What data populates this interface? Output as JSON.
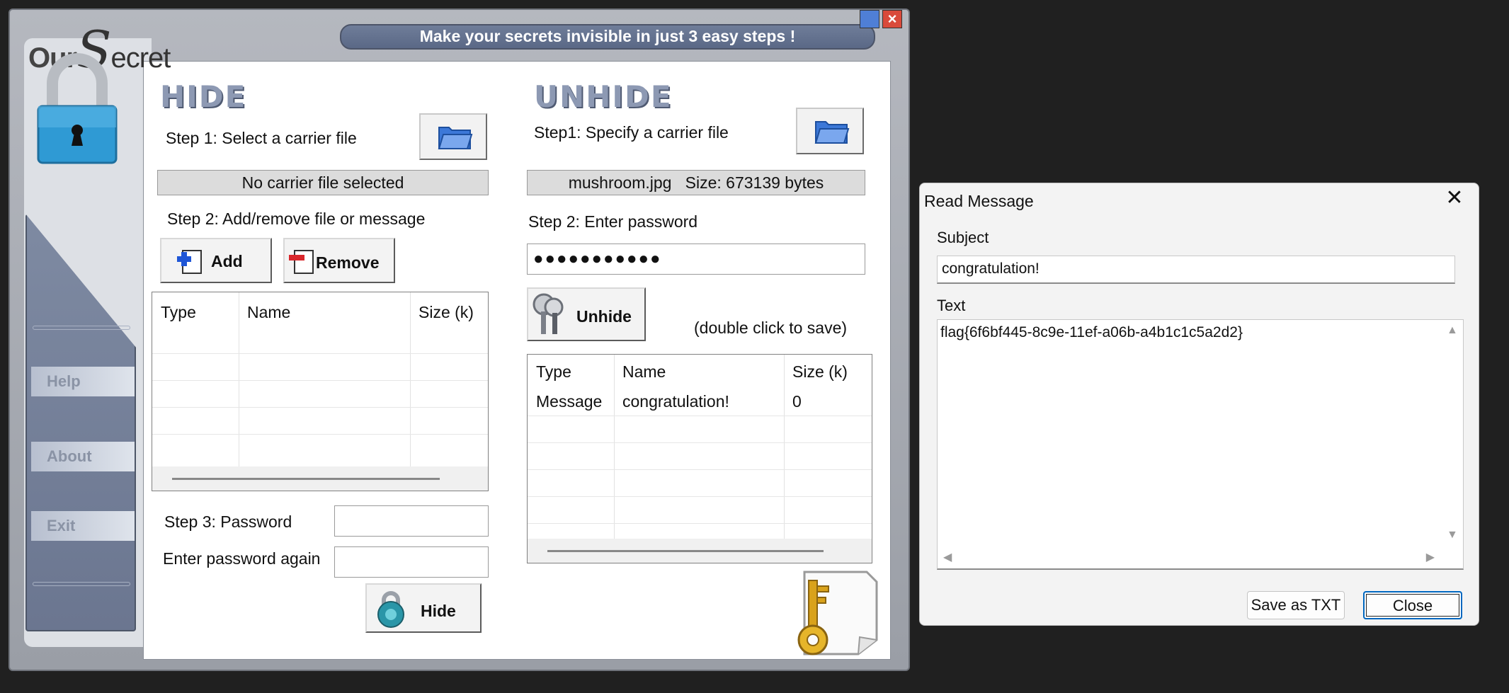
{
  "app": {
    "logo_our": "Our",
    "logo_s": "S",
    "logo_rest": "ecret",
    "banner": "Make your secrets invisible in just 3 easy steps !",
    "nav": {
      "help": "Help",
      "about": "About",
      "exit": "Exit"
    }
  },
  "hide": {
    "title": "HIDE",
    "step1": "Step 1: Select a carrier file",
    "carrier_status": "No carrier file selected",
    "step2": "Step 2: Add/remove file or message",
    "add_label": "Add",
    "remove_label": "Remove",
    "columns": [
      "Type",
      "Name",
      "Size (k)"
    ],
    "step3": "Step 3: Password",
    "password_again": "Enter password again",
    "password_value": "",
    "password_again_value": "",
    "hide_label": "Hide"
  },
  "unhide": {
    "title": "UNHIDE",
    "step1": "Step1: Specify a carrier file",
    "carrier_name": "mushroom.jpg",
    "carrier_size": "Size: 673139 bytes",
    "step2": "Step 2: Enter password",
    "password_masked": "●●●●●●●●●●●",
    "unhide_label": "Unhide",
    "hint": "(double click to save)",
    "columns": [
      "Type",
      "Name",
      "Size (k)"
    ],
    "rows": [
      {
        "type": "Message",
        "name": "congratulation!",
        "size": "0"
      }
    ]
  },
  "dialog": {
    "title": "Read Message",
    "subject_label": "Subject",
    "subject_value": "congratulation!",
    "text_label": "Text",
    "text_value": "flag{6f6bf445-8c9e-11ef-a06b-a4b1c1c5a2d2}",
    "save_txt_label": "Save as TXT",
    "close_label": "Close"
  },
  "colors": {
    "banner": "#5a6886",
    "section_title": "#8d99b3",
    "nav_panel": "#6b7690",
    "focus_blue": "#0067c0"
  },
  "icons": [
    "folder-icon",
    "add-file-icon",
    "remove-file-icon",
    "keys-icon",
    "lock-icon",
    "key-paper-icon",
    "close-icon",
    "minimize-icon"
  ]
}
